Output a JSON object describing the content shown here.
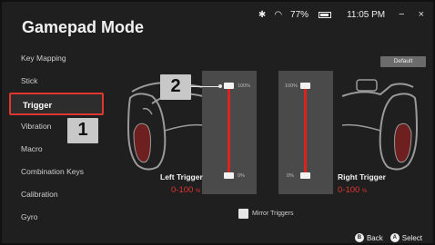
{
  "app": {
    "title": "Gamepad Mode"
  },
  "status": {
    "battery": "77%",
    "time": "11:05 PM",
    "minimize": "−",
    "close": "×"
  },
  "sidebar": {
    "items": [
      {
        "label": "Key Mapping"
      },
      {
        "label": "Stick"
      },
      {
        "label": "Trigger",
        "active": true
      },
      {
        "label": "Vibration"
      },
      {
        "label": "Macro"
      },
      {
        "label": "Combination Keys"
      },
      {
        "label": "Calibration"
      },
      {
        "label": "Gyro"
      }
    ]
  },
  "annotations": {
    "badge_1": "1",
    "badge_2": "2"
  },
  "toolbar": {
    "default_label": "Default"
  },
  "left_trigger": {
    "label": "Left Trigger",
    "range": "0-100",
    "unit": "%",
    "top_pct": "100%",
    "bottom_pct": "0%",
    "value_max": 1.0,
    "value_min": 0.0
  },
  "right_trigger": {
    "label": "Right Trigger",
    "range": "0-100",
    "unit": "%",
    "top_pct": "100%",
    "bottom_pct": "0%",
    "value_max": 1.0,
    "value_min": 0.0
  },
  "mirror": {
    "label": "Mirror Triggers",
    "checked": false
  },
  "footer": {
    "back_key": "B",
    "back_label": "Back",
    "select_key": "A",
    "select_label": "Select"
  },
  "colors": {
    "accent": "#e0362f",
    "panel": "#4a4a4a",
    "background": "#1f1f1f"
  }
}
